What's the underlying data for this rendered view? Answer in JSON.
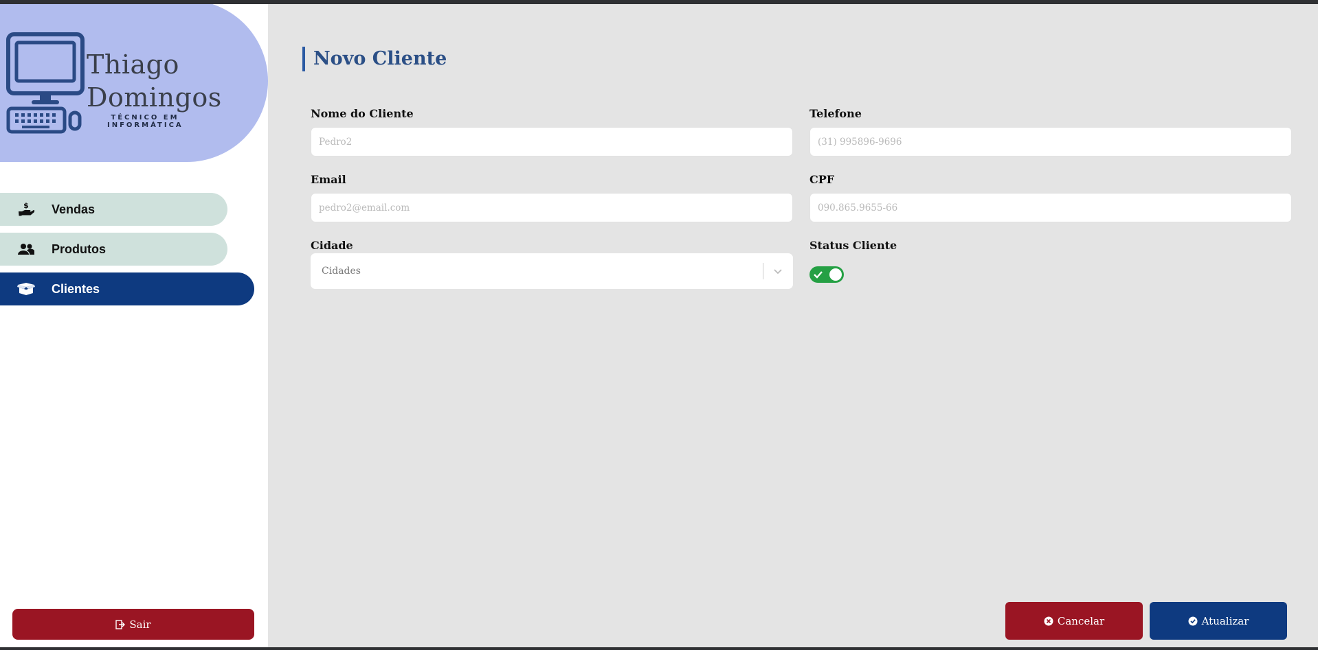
{
  "brand": {
    "name_line1": "Thiago",
    "name_line2": "Domingos",
    "tagline": "TÉCNICO EM INFORMÁTICA",
    "logo_icon": "computer-icon"
  },
  "sidebar": {
    "items": [
      {
        "label": "Vendas",
        "icon": "hand-money-icon",
        "active": false
      },
      {
        "label": "Produtos",
        "icon": "users-icon",
        "active": false
      },
      {
        "label": "Clientes",
        "icon": "box-open-icon",
        "active": true
      }
    ],
    "logout_label": "Sair"
  },
  "form": {
    "title": "Novo Cliente",
    "fields": {
      "nome": {
        "label": "Nome do Cliente",
        "placeholder": "Pedro2"
      },
      "telefone": {
        "label": "Telefone",
        "placeholder": "(31) 995896-9696"
      },
      "email": {
        "label": "Email",
        "placeholder": "pedro2@email.com"
      },
      "cpf": {
        "label": "CPF",
        "placeholder": "090.865.9655-66"
      },
      "cidade": {
        "label": "Cidade",
        "selected": "Cidades"
      },
      "status": {
        "label": "Status Cliente",
        "enabled": true
      }
    },
    "actions": {
      "cancel_label": "Cancelar",
      "submit_label": "Atualizar"
    }
  },
  "colors": {
    "primary": "#0e3a80",
    "danger": "#9a1523",
    "nav_inactive": "#cfe1dc",
    "logo_blob": "#b1bcee",
    "toggle_on": "#25a044"
  }
}
